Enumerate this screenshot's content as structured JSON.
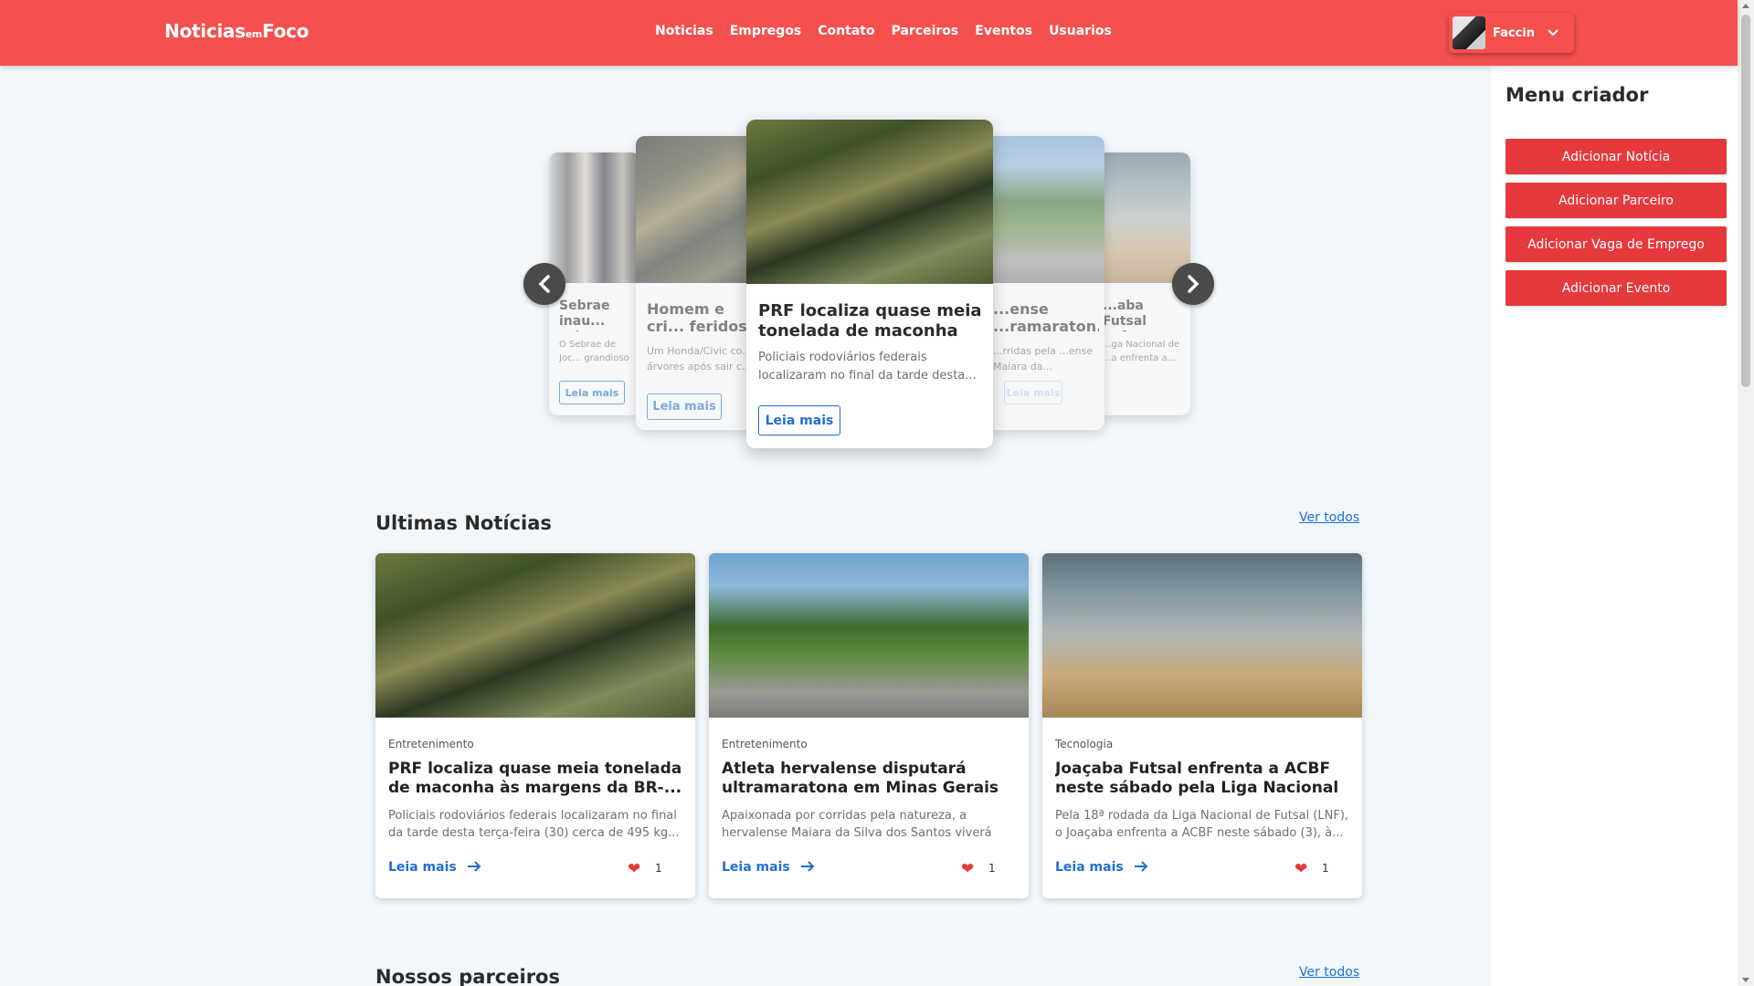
{
  "header": {
    "logo_main": "Noticias",
    "logo_small": "em",
    "logo_end": "Foco",
    "nav": [
      "Noticias",
      "Empregos",
      "Contato",
      "Parceiros",
      "Eventos",
      "Usuarios"
    ],
    "user_name": "Faccin"
  },
  "creator_menu": {
    "title": "Menu criador",
    "buttons": [
      "Adicionar Notícia",
      "Adicionar Parceiro",
      "Adicionar Vaga de Emprego",
      "Adicionar Evento"
    ]
  },
  "carousel": {
    "read_more": "Leia mais",
    "slides": [
      {
        "title": "Sebrae inau... sala em Joc...",
        "text": "O Sebrae de Joc... grandioso event..."
      },
      {
        "title": "Homem e cri... feridos após c...",
        "text": "Um Honda/Civic co... árvores após sair c..."
      },
      {
        "title": "PRF localiza quase meia tonelada de maconha à...",
        "text": "Policiais rodoviários federais localizaram no final da tarde desta..."
      },
      {
        "title": "...ense ...ramaraton...",
        "text": "...rridas pela ...ense Maiara da..."
      },
      {
        "title": "...aba Futsal enfrenta a ...sábado pela...",
        "text": "...ga Nacional de ...a enfrenta a..."
      }
    ]
  },
  "latest": {
    "title": "Ultimas Notícias",
    "see_all": "Ver todos",
    "read_more": "Leia mais",
    "cards": [
      {
        "category": "Entretenimento",
        "title": "PRF localiza quase meia tonelada de maconha às margens da BR-...",
        "desc": "Policiais rodoviários federais localizaram no final da tarde desta terça-feira (30) cerca de 495 kg...",
        "likes": "1",
        "image": "prf"
      },
      {
        "category": "Entretenimento",
        "title": "Atleta hervalense disputará ultramaratona em Minas Gerais",
        "desc": "Apaixonada por corridas pela natureza, a hervalense Maiara da Silva dos Santos viverá su...",
        "likes": "1",
        "image": "run"
      },
      {
        "category": "Tecnologia",
        "title": "Joaçaba Futsal enfrenta a ACBF neste sábado pela Liga Nacional",
        "desc": "Pela 18ª rodada da Liga Nacional de Futsal (LNF), o Joaçaba enfrenta a ACBF neste sábado (3), à...",
        "likes": "1",
        "image": "futsal"
      }
    ]
  },
  "partners": {
    "title": "Nossos parceiros",
    "see_all": "Ver todos"
  },
  "icons": {
    "prev": "chevron-left-icon",
    "next": "chevron-right-icon",
    "user_dropdown": "chevron-down-icon",
    "read_more_arrow": "arrow-right-icon",
    "like": "heart-icon"
  },
  "colors": {
    "brand": "#f55050",
    "button": "#e5393d",
    "link": "#1f6fd0"
  }
}
